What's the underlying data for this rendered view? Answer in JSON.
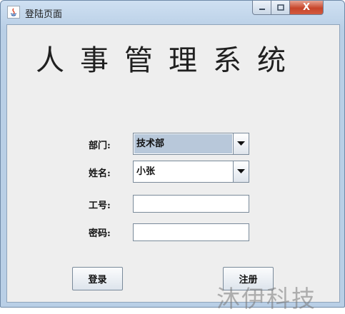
{
  "window": {
    "title": "登陆页面",
    "close_glyph": "X"
  },
  "app_title": "人事管理系统",
  "form": {
    "department_label": "部门:",
    "department_value": "技术部",
    "name_label": "姓名:",
    "name_value": "小张",
    "id_label": "工号:",
    "id_value": "",
    "password_label": "密码:",
    "password_value": ""
  },
  "buttons": {
    "login": "登录",
    "register": "注册"
  },
  "watermark": "沐伊科技"
}
